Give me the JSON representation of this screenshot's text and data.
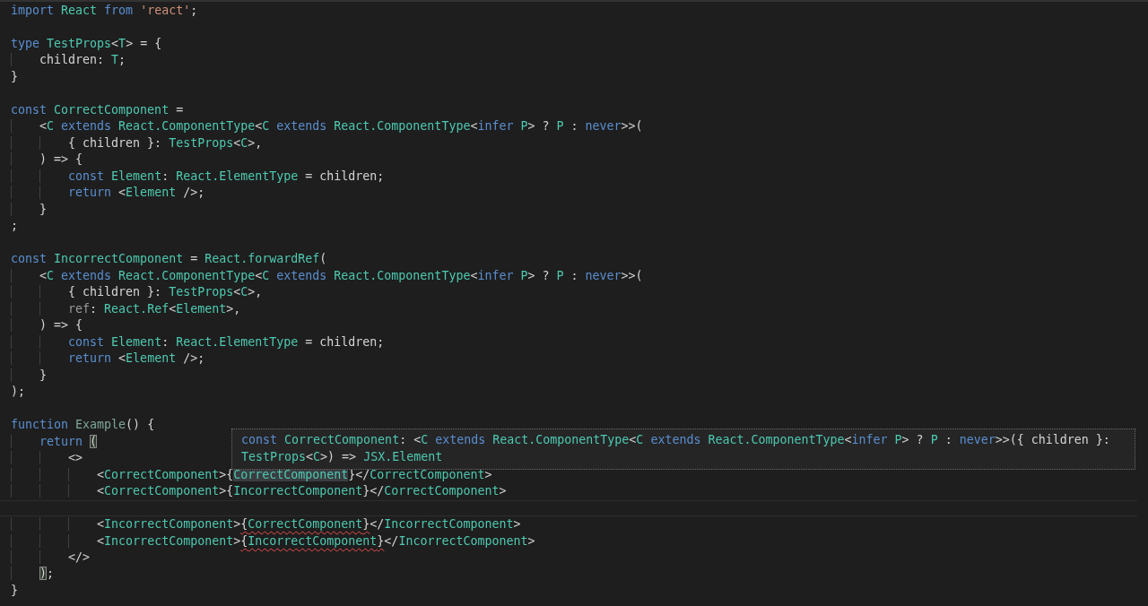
{
  "editor": {
    "lines": [
      {
        "current": false,
        "tokens": [
          {
            "text": "import ",
            "kind": "keyword"
          },
          {
            "text": "React ",
            "kind": "type"
          },
          {
            "text": "from ",
            "kind": "keyword"
          },
          {
            "text": "'react'",
            "kind": "string"
          },
          {
            "text": ";",
            "kind": "plain"
          }
        ]
      },
      {
        "kind": "blank"
      },
      {
        "current": false,
        "tokens": [
          {
            "text": "type ",
            "kind": "keyword"
          },
          {
            "text": "TestProps",
            "kind": "type"
          },
          {
            "text": "<",
            "kind": "plain"
          },
          {
            "text": "T",
            "kind": "type"
          },
          {
            "text": "> = {",
            "kind": "plain"
          }
        ]
      },
      {
        "current": false,
        "tokens": [
          {
            "text": "    children: ",
            "kind": "plain"
          },
          {
            "text": "T",
            "kind": "type"
          },
          {
            "text": ";",
            "kind": "plain"
          }
        ]
      },
      {
        "current": false,
        "tokens": [
          {
            "text": "}",
            "kind": "plain"
          }
        ]
      },
      {
        "kind": "blank"
      },
      {
        "current": false,
        "tokens": [
          {
            "text": "const ",
            "kind": "keyword"
          },
          {
            "text": "CorrectComponent",
            "kind": "type"
          },
          {
            "text": " =",
            "kind": "plain"
          }
        ]
      },
      {
        "current": false,
        "tokens": [
          {
            "text": "    <",
            "kind": "plain"
          },
          {
            "text": "C ",
            "kind": "type"
          },
          {
            "text": "extends ",
            "kind": "keyword"
          },
          {
            "text": "React.ComponentType",
            "kind": "type"
          },
          {
            "text": "<",
            "kind": "plain"
          },
          {
            "text": "C ",
            "kind": "type"
          },
          {
            "text": "extends ",
            "kind": "keyword"
          },
          {
            "text": "React.ComponentType",
            "kind": "type"
          },
          {
            "text": "<",
            "kind": "plain"
          },
          {
            "text": "infer ",
            "kind": "keyword"
          },
          {
            "text": "P",
            "kind": "type"
          },
          {
            "text": "> ? ",
            "kind": "plain"
          },
          {
            "text": "P",
            "kind": "type"
          },
          {
            "text": " : ",
            "kind": "plain"
          },
          {
            "text": "never",
            "kind": "keyword"
          },
          {
            "text": ">>(",
            "kind": "plain"
          }
        ]
      },
      {
        "current": false,
        "tokens": [
          {
            "text": "        { children }: ",
            "kind": "plain"
          },
          {
            "text": "TestProps",
            "kind": "type"
          },
          {
            "text": "<",
            "kind": "plain"
          },
          {
            "text": "C",
            "kind": "type"
          },
          {
            "text": ">,",
            "kind": "plain"
          }
        ]
      },
      {
        "current": false,
        "tokens": [
          {
            "text": "    ) => {",
            "kind": "plain"
          }
        ]
      },
      {
        "current": false,
        "tokens": [
          {
            "text": "        const ",
            "kind": "keyword"
          },
          {
            "text": "Element",
            "kind": "type"
          },
          {
            "text": ": ",
            "kind": "plain"
          },
          {
            "text": "React.ElementType",
            "kind": "type"
          },
          {
            "text": " = children;",
            "kind": "plain"
          }
        ]
      },
      {
        "current": false,
        "tokens": [
          {
            "text": "        return",
            "kind": "keyword"
          },
          {
            "text": " <",
            "kind": "plain"
          },
          {
            "text": "Element",
            "kind": "type"
          },
          {
            "text": " />;",
            "kind": "plain"
          }
        ]
      },
      {
        "current": false,
        "tokens": [
          {
            "text": "    }",
            "kind": "plain"
          }
        ]
      },
      {
        "current": false,
        "tokens": [
          {
            "text": ";",
            "kind": "plain"
          }
        ]
      },
      {
        "kind": "blank"
      },
      {
        "current": false,
        "tokens": [
          {
            "text": "const ",
            "kind": "keyword"
          },
          {
            "text": "IncorrectComponent",
            "kind": "type"
          },
          {
            "text": " = ",
            "kind": "plain"
          },
          {
            "text": "React.forwardRef",
            "kind": "type"
          },
          {
            "text": "(",
            "kind": "plain"
          }
        ]
      },
      {
        "current": false,
        "tokens": [
          {
            "text": "    <",
            "kind": "plain"
          },
          {
            "text": "C ",
            "kind": "type"
          },
          {
            "text": "extends ",
            "kind": "keyword"
          },
          {
            "text": "React.ComponentType",
            "kind": "type"
          },
          {
            "text": "<",
            "kind": "plain"
          },
          {
            "text": "C ",
            "kind": "type"
          },
          {
            "text": "extends ",
            "kind": "keyword"
          },
          {
            "text": "React.ComponentType",
            "kind": "type"
          },
          {
            "text": "<",
            "kind": "plain"
          },
          {
            "text": "infer ",
            "kind": "keyword"
          },
          {
            "text": "P",
            "kind": "type"
          },
          {
            "text": "> ? ",
            "kind": "plain"
          },
          {
            "text": "P",
            "kind": "type"
          },
          {
            "text": " : ",
            "kind": "plain"
          },
          {
            "text": "never",
            "kind": "keyword"
          },
          {
            "text": ">>(",
            "kind": "plain"
          }
        ]
      },
      {
        "current": false,
        "tokens": [
          {
            "text": "        { children }: ",
            "kind": "plain"
          },
          {
            "text": "TestProps",
            "kind": "type"
          },
          {
            "text": "<",
            "kind": "plain"
          },
          {
            "text": "C",
            "kind": "type"
          },
          {
            "text": ">,",
            "kind": "plain"
          }
        ]
      },
      {
        "current": false,
        "tokens": [
          {
            "text": "        ref",
            "kind": "unused"
          },
          {
            "text": ": ",
            "kind": "plain"
          },
          {
            "text": "React.Ref",
            "kind": "type"
          },
          {
            "text": "<",
            "kind": "plain"
          },
          {
            "text": "Element",
            "kind": "type"
          },
          {
            "text": ">,",
            "kind": "plain"
          }
        ]
      },
      {
        "current": false,
        "tokens": [
          {
            "text": "    ) => {",
            "kind": "plain"
          }
        ]
      },
      {
        "current": false,
        "tokens": [
          {
            "text": "        const ",
            "kind": "keyword"
          },
          {
            "text": "Element",
            "kind": "type"
          },
          {
            "text": ": ",
            "kind": "plain"
          },
          {
            "text": "React.ElementType",
            "kind": "type"
          },
          {
            "text": " = children;",
            "kind": "plain"
          }
        ]
      },
      {
        "current": false,
        "tokens": [
          {
            "text": "        return",
            "kind": "keyword"
          },
          {
            "text": " <",
            "kind": "plain"
          },
          {
            "text": "Element",
            "kind": "type"
          },
          {
            "text": " />;",
            "kind": "plain"
          }
        ]
      },
      {
        "current": false,
        "tokens": [
          {
            "text": "    }",
            "kind": "plain"
          }
        ]
      },
      {
        "current": false,
        "tokens": [
          {
            "text": ");",
            "kind": "plain"
          }
        ]
      },
      {
        "kind": "blank"
      },
      {
        "current": false,
        "tokens": [
          {
            "text": "function ",
            "kind": "keyword"
          },
          {
            "text": "Example",
            "kind": "unusedfunction"
          },
          {
            "text": "() {",
            "kind": "plain"
          }
        ]
      },
      {
        "current": false,
        "tokens": [
          {
            "text": "    return ",
            "kind": "keyword"
          },
          {
            "text": "(",
            "kind": "bracketmatch"
          }
        ]
      },
      {
        "current": false,
        "tokens": [
          {
            "text": "        <>",
            "kind": "plain"
          }
        ]
      },
      {
        "current": false,
        "tokens": [
          {
            "text": "            <",
            "kind": "plain"
          },
          {
            "text": "CorrectComponent",
            "kind": "type"
          },
          {
            "text": ">{",
            "kind": "plain"
          },
          {
            "text": "CorrectComponent",
            "kind": "typehover"
          },
          {
            "text": "}</",
            "kind": "plain"
          },
          {
            "text": "CorrectComponent",
            "kind": "type"
          },
          {
            "text": ">",
            "kind": "plain"
          }
        ]
      },
      {
        "current": false,
        "tokens": [
          {
            "text": "            <",
            "kind": "plain"
          },
          {
            "text": "CorrectComponent",
            "kind": "type"
          },
          {
            "text": ">{",
            "kind": "plain"
          },
          {
            "text": "IncorrectComponent",
            "kind": "type"
          },
          {
            "text": "}</",
            "kind": "plain"
          },
          {
            "text": "CorrectComponent",
            "kind": "type"
          },
          {
            "text": ">",
            "kind": "plain"
          }
        ]
      },
      {
        "kind": "blank",
        "current": true
      },
      {
        "current": false,
        "tokens": [
          {
            "text": "            <",
            "kind": "plain"
          },
          {
            "text": "IncorrectComponent",
            "kind": "type"
          },
          {
            "text": ">",
            "kind": "plain"
          },
          {
            "text": "{",
            "kind": "plainerror"
          },
          {
            "text": "CorrectComponent",
            "kind": "typeerror"
          },
          {
            "text": "}",
            "kind": "plainerror"
          },
          {
            "text": "</",
            "kind": "plain"
          },
          {
            "text": "IncorrectComponent",
            "kind": "type"
          },
          {
            "text": ">",
            "kind": "plain"
          }
        ]
      },
      {
        "current": false,
        "tokens": [
          {
            "text": "            <",
            "kind": "plain"
          },
          {
            "text": "IncorrectComponent",
            "kind": "type"
          },
          {
            "text": ">",
            "kind": "plain"
          },
          {
            "text": "{",
            "kind": "plainerror"
          },
          {
            "text": "IncorrectComponent",
            "kind": "typeerror"
          },
          {
            "text": "}",
            "kind": "plainerror"
          },
          {
            "text": "</",
            "kind": "plain"
          },
          {
            "text": "IncorrectComponent",
            "kind": "type"
          },
          {
            "text": ">",
            "kind": "plain"
          }
        ]
      },
      {
        "current": false,
        "tokens": [
          {
            "text": "        </>",
            "kind": "plain"
          }
        ]
      },
      {
        "current": false,
        "tokens": [
          {
            "text": "    )",
            "kind": "bracketmatch"
          },
          {
            "text": ";",
            "kind": "plain"
          }
        ]
      },
      {
        "current": false,
        "tokens": [
          {
            "text": "}",
            "kind": "plain"
          }
        ]
      }
    ]
  },
  "hover_tooltip": {
    "lines": [
      {
        "tokens": [
          {
            "text": "const ",
            "kind": "keyword"
          },
          {
            "text": "CorrectComponent",
            "kind": "type"
          },
          {
            "text": ": <",
            "kind": "plain"
          },
          {
            "text": "C ",
            "kind": "type"
          },
          {
            "text": "extends ",
            "kind": "keyword"
          },
          {
            "text": "React.ComponentType",
            "kind": "type"
          },
          {
            "text": "<",
            "kind": "plain"
          },
          {
            "text": "C ",
            "kind": "type"
          },
          {
            "text": "extends ",
            "kind": "keyword"
          },
          {
            "text": "React.ComponentType",
            "kind": "type"
          },
          {
            "text": "<",
            "kind": "plain"
          },
          {
            "text": "infer ",
            "kind": "keyword"
          },
          {
            "text": "P",
            "kind": "type"
          },
          {
            "text": "> ? ",
            "kind": "plain"
          },
          {
            "text": "P",
            "kind": "type"
          },
          {
            "text": " : ",
            "kind": "plain"
          },
          {
            "text": "never",
            "kind": "keyword"
          },
          {
            "text": ">>({ children }:",
            "kind": "plain"
          }
        ]
      },
      {
        "tokens": [
          {
            "text": "TestProps",
            "kind": "type"
          },
          {
            "text": "<",
            "kind": "plain"
          },
          {
            "text": "C",
            "kind": "type"
          },
          {
            "text": ">) => ",
            "kind": "plain"
          },
          {
            "text": "JSX.Element",
            "kind": "type"
          }
        ]
      }
    ]
  }
}
